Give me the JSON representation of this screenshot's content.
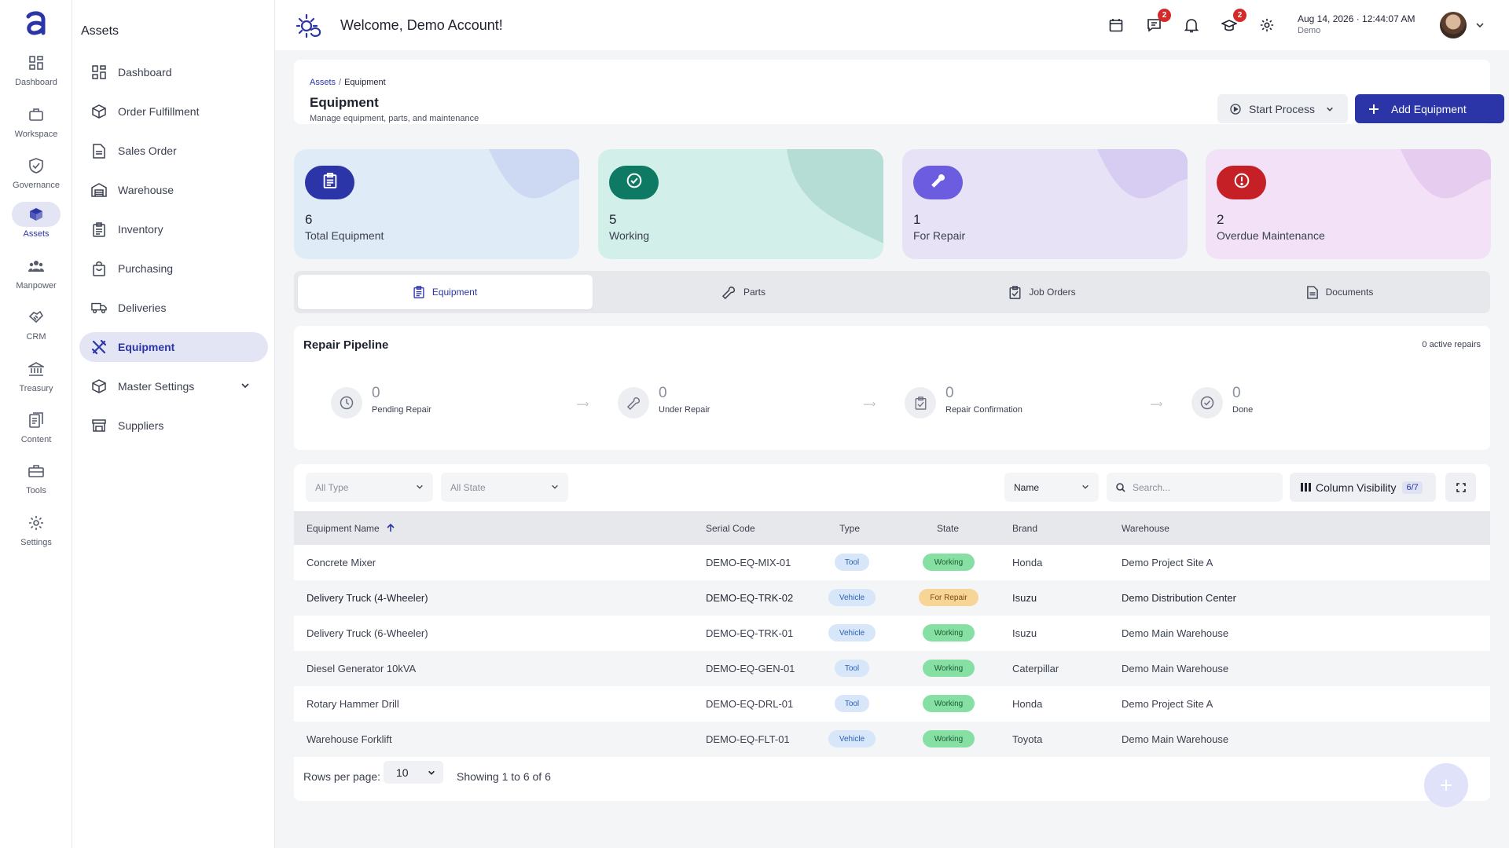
{
  "rail": {
    "items": [
      {
        "label": "Dashboard",
        "icon": "grid-icon"
      },
      {
        "label": "Workspace",
        "icon": "briefcase-icon"
      },
      {
        "label": "Governance",
        "icon": "shield-check-icon"
      },
      {
        "label": "Assets",
        "icon": "cube-icon"
      },
      {
        "label": "Manpower",
        "icon": "people-icon"
      },
      {
        "label": "CRM",
        "icon": "handshake-icon"
      },
      {
        "label": "Treasury",
        "icon": "bank-icon"
      },
      {
        "label": "Content",
        "icon": "document-icon"
      },
      {
        "label": "Tools",
        "icon": "toolbox-icon"
      },
      {
        "label": "Settings",
        "icon": "gear-icon"
      }
    ],
    "active": "Assets"
  },
  "sidebar": {
    "title": "Assets",
    "items": [
      {
        "label": "Dashboard",
        "icon": "grid-icon"
      },
      {
        "label": "Order Fulfillment",
        "icon": "box-icon"
      },
      {
        "label": "Sales Order",
        "icon": "document-icon"
      },
      {
        "label": "Warehouse",
        "icon": "warehouse-icon"
      },
      {
        "label": "Inventory",
        "icon": "clipboard-icon"
      },
      {
        "label": "Purchasing",
        "icon": "bag-icon"
      },
      {
        "label": "Deliveries",
        "icon": "truck-icon"
      },
      {
        "label": "Equipment",
        "icon": "tools-icon"
      },
      {
        "label": "Master Settings",
        "icon": "cube-icon"
      },
      {
        "label": "Suppliers",
        "icon": "store-icon"
      }
    ],
    "active": "Equipment"
  },
  "header": {
    "title": "Welcome, Demo Account!",
    "messages_badge": "2",
    "learning_badge": "2",
    "date": "Aug 14, 2026 · 12:44:07 AM",
    "user": "Demo"
  },
  "page": {
    "breadcrumb_root": "Assets",
    "breadcrumb_sep": "/",
    "breadcrumb_current": "Equipment",
    "title": "Equipment",
    "subtitle": "Manage equipment, parts, and maintenance",
    "start_process_label": "Start Process",
    "add_equipment_label": "Add Equipment"
  },
  "stats": [
    {
      "value": "6",
      "label": "Total Equipment",
      "bg": "#e0ebf8",
      "icon_bg": "#2b35a8",
      "wave": "#cdd9f3",
      "icon": "clipboard-icon"
    },
    {
      "value": "5",
      "label": "Working",
      "bg": "#d2f0e9",
      "icon_bg": "#0f7a63",
      "wave": "#b5ddd6",
      "icon": "check-circle-icon"
    },
    {
      "value": "1",
      "label": "For Repair",
      "bg": "#e8e2f7",
      "icon_bg": "#6b5ce0",
      "wave": "#d7cdf3",
      "icon": "wrench-icon"
    },
    {
      "value": "2",
      "label": "Overdue Maintenance",
      "bg": "#f3e2f7",
      "icon_bg": "#c42026",
      "wave": "#e6cdf0",
      "icon": "alert-circle-icon"
    }
  ],
  "tabs": [
    {
      "label": "Equipment",
      "icon": "clipboard-icon"
    },
    {
      "label": "Parts",
      "icon": "wrench-icon"
    },
    {
      "label": "Job Orders",
      "icon": "clipboard-check-icon"
    },
    {
      "label": "Documents",
      "icon": "document-icon"
    }
  ],
  "pipeline": {
    "title": "Repair Pipeline",
    "active_count": "0 active repairs",
    "steps": [
      {
        "value": "0",
        "label": "Pending Repair",
        "icon": "clock-icon"
      },
      {
        "value": "0",
        "label": "Under Repair",
        "icon": "wrench-icon"
      },
      {
        "value": "0",
        "label": "Repair Confirmation",
        "icon": "clipboard-check-icon"
      },
      {
        "value": "0",
        "label": "Done",
        "icon": "check-circle-icon"
      }
    ],
    "arrow": "—›"
  },
  "table": {
    "filter_type": "All Type",
    "filter_state": "All State",
    "sort_by": "Name",
    "search_placeholder": "Search...",
    "column_visibility_label": "Column Visibility",
    "column_visibility_count": "6/7",
    "columns": [
      "Equipment Name",
      "Serial Code",
      "Type",
      "State",
      "Brand",
      "Warehouse"
    ],
    "rows": [
      {
        "name": "Concrete Mixer",
        "serial": "DEMO-EQ-MIX-01",
        "type": "Tool",
        "state": "Working",
        "brand": "Honda",
        "warehouse": "Demo Project Site A"
      },
      {
        "name": "Delivery Truck (4-Wheeler)",
        "serial": "DEMO-EQ-TRK-02",
        "type": "Vehicle",
        "state": "For Repair",
        "brand": "Isuzu",
        "warehouse": "Demo Distribution Center"
      },
      {
        "name": "Delivery Truck (6-Wheeler)",
        "serial": "DEMO-EQ-TRK-01",
        "type": "Vehicle",
        "state": "Working",
        "brand": "Isuzu",
        "warehouse": "Demo Main Warehouse"
      },
      {
        "name": "Diesel Generator 10kVA",
        "serial": "DEMO-EQ-GEN-01",
        "type": "Tool",
        "state": "Working",
        "brand": "Caterpillar",
        "warehouse": "Demo Main Warehouse"
      },
      {
        "name": "Rotary Hammer Drill",
        "serial": "DEMO-EQ-DRL-01",
        "type": "Tool",
        "state": "Working",
        "brand": "Honda",
        "warehouse": "Demo Project Site A"
      },
      {
        "name": "Warehouse Forklift",
        "serial": "DEMO-EQ-FLT-01",
        "type": "Vehicle",
        "state": "Working",
        "brand": "Toyota",
        "warehouse": "Demo Main Warehouse"
      }
    ],
    "rows_per_page_label": "Rows per page:",
    "rows_per_page": "10",
    "showing": "Showing 1 to 6 of 6"
  },
  "colors": {
    "primary": "#2b35a8",
    "working": "#86e0a3",
    "for_repair": "#f7d596",
    "type_pill": "#d7e6f8"
  }
}
